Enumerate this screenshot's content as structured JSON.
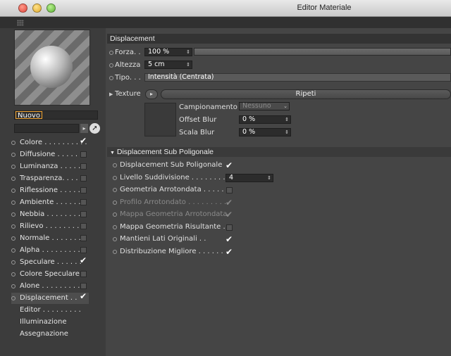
{
  "window": {
    "title": "Editor Materiale"
  },
  "material": {
    "name": "Nuovo"
  },
  "channels": [
    {
      "label": "Colore . . . . . . . . . .",
      "checked": true
    },
    {
      "label": "Diffusione . . . . .",
      "checked": false
    },
    {
      "label": "Luminanza . . . . .",
      "checked": false
    },
    {
      "label": "Trasparenza. . . .",
      "checked": false
    },
    {
      "label": "Riflessione . . . . .",
      "checked": false
    },
    {
      "label": "Ambiente . . . . . .",
      "checked": false
    },
    {
      "label": "Nebbia . . . . . . . .",
      "checked": false
    },
    {
      "label": "Rilievo . . . . . . . .",
      "checked": false
    },
    {
      "label": "Normale . . . . . . .",
      "checked": false
    },
    {
      "label": "Alpha . . . . . . . . .",
      "checked": false
    },
    {
      "label": "Speculare . . . . . .",
      "checked": true
    },
    {
      "label": "Colore Speculare",
      "checked": false
    },
    {
      "label": "Alone . . . . . . . . .",
      "checked": false
    },
    {
      "label": "Displacement . .",
      "checked": true,
      "selected": true
    }
  ],
  "extra_channels": [
    {
      "label": "Editor . . . . . . . . ."
    },
    {
      "label": "Illuminazione"
    },
    {
      "label": "Assegnazione"
    }
  ],
  "displacement": {
    "header": "Displacement",
    "forza_label": "Forza. .",
    "forza_value": "100 %",
    "altezza_label": "Altezza",
    "altezza_value": "5 cm",
    "tipo_label": "Tipo. . .",
    "tipo_value": "Intensità (Centrata)",
    "texture_label": "Texture",
    "texture_button": "Ripeti",
    "campionamento_label": "Campionamento",
    "campionamento_value": "Nessuno",
    "offset_label": "Offset Blur",
    "offset_value": "0 %",
    "scala_label": "Scala Blur",
    "scala_value": "0 %"
  },
  "subpoly": {
    "header": "Displacement Sub Poligonale",
    "rows": [
      {
        "label": "Displacement Sub Poligonale",
        "state": "checked"
      },
      {
        "label": "Livello Suddivisione . . . . . . . . .",
        "state": "field",
        "value": "4"
      },
      {
        "label": "Geometria Arrotondata . . . . .",
        "state": "unchecked"
      },
      {
        "label": "Profilo Arrotondato . . . . . . . . .",
        "state": "dim-checked"
      },
      {
        "label": "Mappa Geometria Arrotondata",
        "state": "dim-checked"
      },
      {
        "label": "Mappa Geometria Risultante .",
        "state": "unchecked"
      },
      {
        "label": "Mantieni Lati Originali . .",
        "state": "checked"
      },
      {
        "label": "Distribuzione Migliore . . . . . .",
        "state": "checked"
      }
    ]
  }
}
